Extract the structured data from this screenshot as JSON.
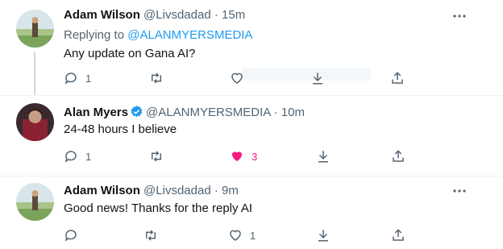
{
  "tweets": [
    {
      "name": "Adam Wilson",
      "handle": "@Livsdadad",
      "dot": "·",
      "time": "15m",
      "replying_prefix": "Replying to ",
      "replying_handle": "@ALANMYERSMEDIA",
      "text": "Any update on Gana AI?",
      "reply_count": "1",
      "retweet_count": "",
      "like_count": ""
    },
    {
      "name": "Alan Myers",
      "handle": "@ALANMYERSMEDIA",
      "dot": "·",
      "time": "10m",
      "text": "24-48 hours I believe",
      "reply_count": "1",
      "retweet_count": "",
      "like_count": "3",
      "liked": true
    },
    {
      "name": "Adam Wilson",
      "handle": "@Livsdadad",
      "dot": "·",
      "time": "9m",
      "text": "Good news! Thanks for the reply AI",
      "reply_count": "",
      "retweet_count": "",
      "like_count": "1"
    }
  ],
  "icons": {
    "more": "more-horizontal-icon",
    "reply": "reply-icon",
    "retweet": "retweet-icon",
    "like": "heart-icon",
    "download": "download-icon",
    "share": "share-icon",
    "verified": "verified-badge-icon"
  },
  "colors": {
    "link": "#1d9bf0",
    "muted": "#536471",
    "like": "#f91880",
    "verified": "#1d9bf0"
  }
}
